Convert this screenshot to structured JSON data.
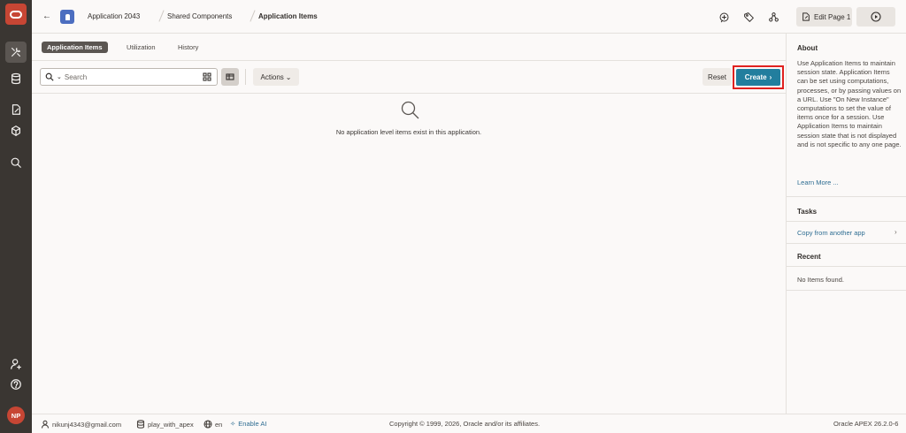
{
  "header": {
    "breadcrumbs": [
      "Application 2043",
      "Shared Components",
      "Application Items"
    ],
    "edit_label": "Edit Page 1"
  },
  "tabs": [
    {
      "label": "Application Items",
      "active": true
    },
    {
      "label": "Utilization",
      "active": false
    },
    {
      "label": "History",
      "active": false
    }
  ],
  "toolbar": {
    "search_placeholder": "Search",
    "actions_label": "Actions",
    "reset_label": "Reset",
    "create_label": "Create"
  },
  "main": {
    "empty_message": "No application level items exist in this application."
  },
  "panel": {
    "about": {
      "title": "About",
      "text": "Use Application Items to maintain session state. Application Items can be set using computations, processes, or by passing values on a URL. Use \"On New Instance\" computations to set the value of items once for a session. Use Application Items to maintain session state that is not displayed and is not specific to any one page.",
      "link": "Learn More ..."
    },
    "tasks": {
      "title": "Tasks",
      "items": [
        "Copy from another app"
      ]
    },
    "recent": {
      "title": "Recent",
      "empty": "No Items found."
    }
  },
  "footer": {
    "user": "nikunj4343@gmail.com",
    "workspace": "play_with_apex",
    "language": "en",
    "ai_label": "Enable AI",
    "copyright": "Copyright © 1999, 2026, Oracle and/or its affiliates.",
    "version": "Oracle APEX 26.2.0-6"
  },
  "user": {
    "initials": "NP"
  },
  "colors": {
    "nav_bg": "#3a3632",
    "brand": "#c74634",
    "primary": "#227e9e",
    "highlight": "#e0211f",
    "link": "#2e6d92"
  }
}
